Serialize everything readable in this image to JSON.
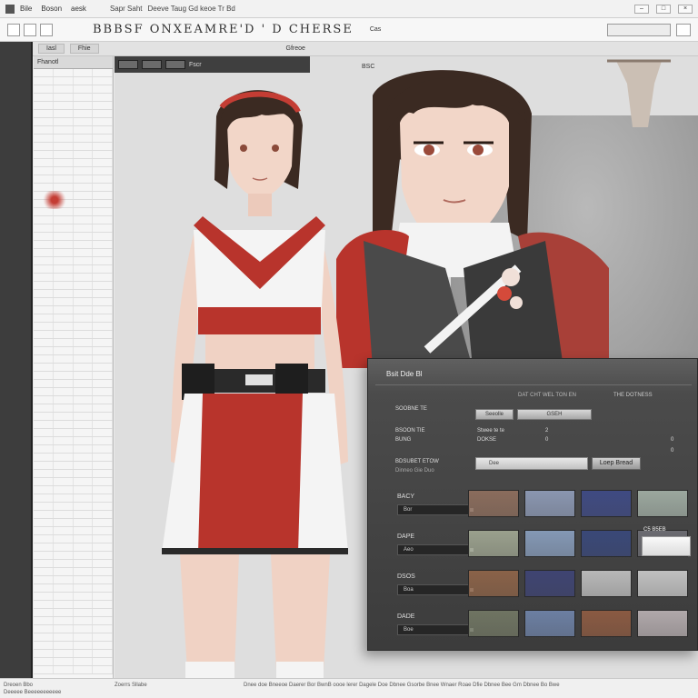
{
  "window": {
    "menu": [
      "Bile",
      "Boson",
      "aesk"
    ],
    "path": "Sapr Saht",
    "path_detail": "Deeve Taug  Gd  keoe  Tr Bd",
    "sub_path": "Gfreoe"
  },
  "toolbar": {
    "doc_title": "BBBSF  ONXEAMRE'D  ' D  CHERSE",
    "search_value": "",
    "extra": "Cas"
  },
  "sub_tabs": [
    "Iasl",
    "Fhie"
  ],
  "layer_panel": {
    "header": "Fhanotl",
    "row_count": 74
  },
  "canvas": {
    "strip_label": "Fscr",
    "label": "BSC"
  },
  "float_panel": {
    "title": "Bsit Dde Bl",
    "heading_left": "SOOBNE TE",
    "heading_right": "DAT CHT WEL TON EN",
    "heading_far": "THE DOTNESS",
    "rows": [
      {
        "label": "BSOON TIE",
        "value": "2"
      },
      {
        "label": "BUNG",
        "value": "0"
      },
      {
        "label": "DOKSE",
        "value": "0"
      }
    ],
    "btn1": "Seeolle",
    "btn2": "GSEH",
    "subrow_label": "Stwee te te",
    "subrow_value": "0",
    "big_label": "BDSUBET ETOW",
    "big_sublabel": "Dinneo  Gie  Duo",
    "big_field": "Dee",
    "big_button": "Loep Bread",
    "badge": "C5 B5EB",
    "swatch_rows": [
      {
        "label": "BACY",
        "field": "Bor",
        "colors": [
          "#8a6c5c",
          "#8a96b0",
          "#3f4a82",
          "#9ba79e"
        ]
      },
      {
        "label": "DAPE",
        "field": "Aeo",
        "colors": [
          "#9aa08d",
          "#8498b5",
          "#3a4878",
          "#6a6a70"
        ]
      },
      {
        "label": "DSOS",
        "field": "Boa",
        "colors": [
          "#8a6248",
          "#3f4472",
          "#b8b8b8",
          "#c0c0c0"
        ]
      },
      {
        "label": "DADE",
        "field": "Boe",
        "colors": [
          "#6f7462",
          "#6c7fa2",
          "#8a5a42",
          "#b0a8aa"
        ]
      }
    ]
  },
  "statusbar": {
    "left": "Dreoen Bbo",
    "left2": "Deeeee Beeeeeeeeeee",
    "mid": "Zoerrs Sllabe",
    "right": "Dnee doe Bneeoe Daerer Bor BwnB oooe lerer Dagele Doe Dbnee Gsorbe Bnee Wnaer Roae Dfie Dbnee Bee Gm Dbnee Bo Bwe"
  },
  "colors": {
    "accent_red": "#b8342c",
    "panel_dark": "#3c3c3c",
    "canvas_bg": "#dedede"
  }
}
